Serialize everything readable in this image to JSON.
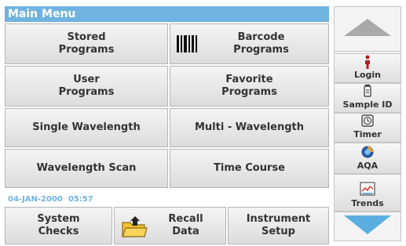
{
  "title": "Main Menu",
  "menu": {
    "stored_programs": "Stored\nPrograms",
    "barcode_programs": "Barcode\nPrograms",
    "user_programs": "User\nPrograms",
    "favorite_programs": "Favorite\nPrograms",
    "single_wavelength": "Single Wavelength",
    "multi_wavelength": "Multi - Wavelength",
    "wavelength_scan": "Wavelength Scan",
    "time_course": "Time Course"
  },
  "datetime": "04-JAN-2000  05:57",
  "bottom": {
    "system_checks": "System\nChecks",
    "recall_data": "Recall\nData",
    "instrument_setup": "Instrument\nSetup"
  },
  "sidebar": {
    "login": "Login",
    "sample_id": "Sample ID",
    "timer": "Timer",
    "aqa": "AQA",
    "trends": "Trends"
  },
  "colors": {
    "accent": "#6fb3e0",
    "arrow_up": "#a9a9a9",
    "arrow_down": "#5aaee0"
  }
}
